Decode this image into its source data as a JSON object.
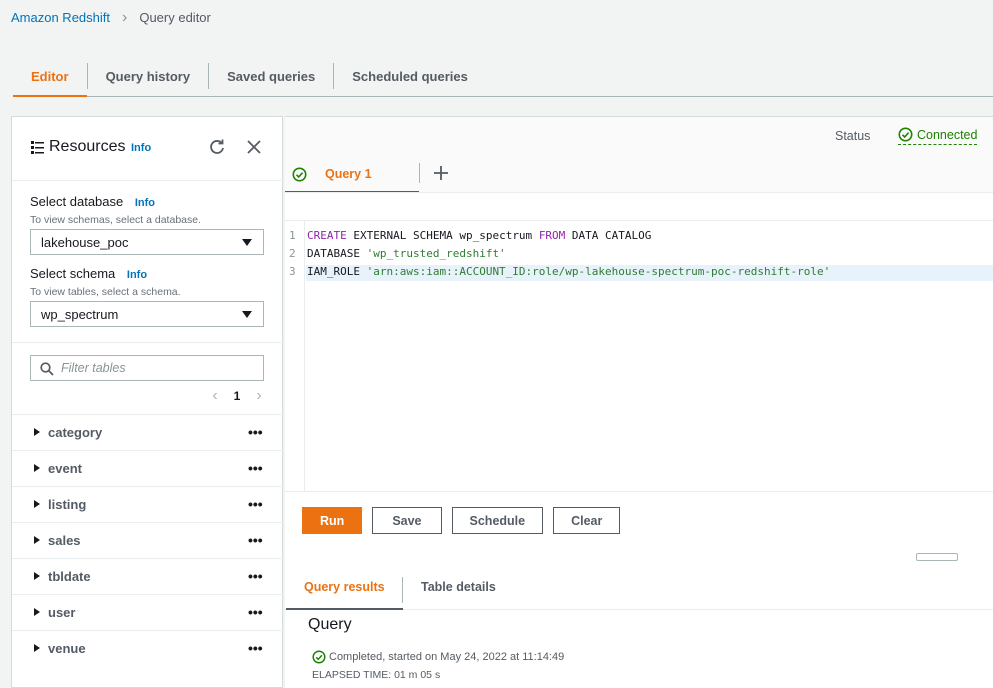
{
  "breadcrumb": {
    "root": "Amazon Redshift",
    "current": "Query editor"
  },
  "top_tabs": [
    {
      "label": "Editor",
      "active": true
    },
    {
      "label": "Query history",
      "active": false
    },
    {
      "label": "Saved queries",
      "active": false
    },
    {
      "label": "Scheduled queries",
      "active": false
    }
  ],
  "resources": {
    "title": "Resources",
    "info": "Info",
    "database": {
      "label": "Select database",
      "info": "Info",
      "hint": "To view schemas, select a database.",
      "value": "lakehouse_poc"
    },
    "schema": {
      "label": "Select schema",
      "info": "Info",
      "hint": "To view tables, select a schema.",
      "value": "wp_spectrum"
    },
    "filter_placeholder": "Filter tables",
    "page": "1",
    "tables": [
      "category",
      "event",
      "listing",
      "sales",
      "tbldate",
      "user",
      "venue"
    ],
    "row_menu": "•••"
  },
  "status": {
    "label": "Status",
    "value": "Connected"
  },
  "query_tab": {
    "label": "Query 1",
    "add": "+"
  },
  "editor": {
    "line_numbers": [
      "1",
      "2",
      "3"
    ]
  },
  "buttons": {
    "run": "Run",
    "save": "Save",
    "schedule": "Schedule",
    "clear": "Clear"
  },
  "results": {
    "tabs": [
      "Query results",
      "Table details"
    ],
    "title": "Query",
    "status_text": "Completed, started on May 24, 2022 at 11:14:49",
    "elapsed": "ELAPSED TIME: 01 m 05 s"
  },
  "colors": {
    "accent": "#ec7211",
    "link": "#0073bb",
    "success": "#1d8102"
  }
}
